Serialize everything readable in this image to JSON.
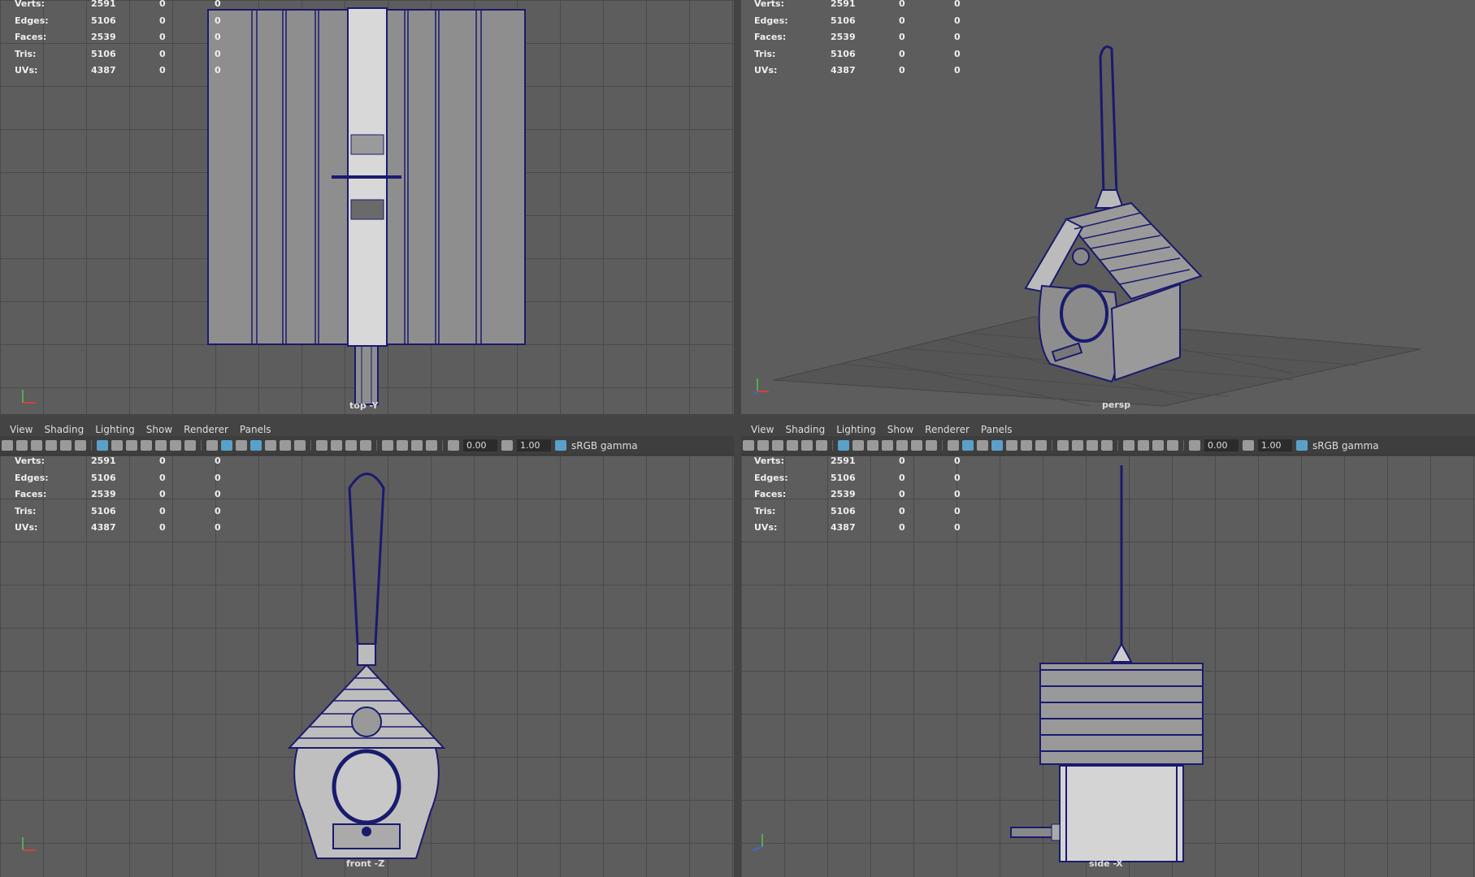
{
  "menu": [
    "View",
    "Shading",
    "Lighting",
    "Show",
    "Renderer",
    "Panels"
  ],
  "toolbar": {
    "exposure": "0.00",
    "gamma": "1.00",
    "colorspace": "sRGB gamma"
  },
  "hud": {
    "rows": [
      {
        "label": "Verts:",
        "v1": "2591",
        "v2": "0",
        "v3": "0"
      },
      {
        "label": "Edges:",
        "v1": "5106",
        "v2": "0",
        "v3": "0"
      },
      {
        "label": "Faces:",
        "v1": "2539",
        "v2": "0",
        "v3": "0"
      },
      {
        "label": "Tris:",
        "v1": "5106",
        "v2": "0",
        "v3": "0"
      },
      {
        "label": "UVs:",
        "v1": "4387",
        "v2": "0",
        "v3": "0"
      }
    ]
  },
  "cameras": {
    "top": "top -Y",
    "persp": "persp",
    "front": "front -Z",
    "side": "side -X"
  },
  "colors": {
    "viewport": "#5d5d5d",
    "wire": "#1a1a6e",
    "panel": "#444444"
  }
}
